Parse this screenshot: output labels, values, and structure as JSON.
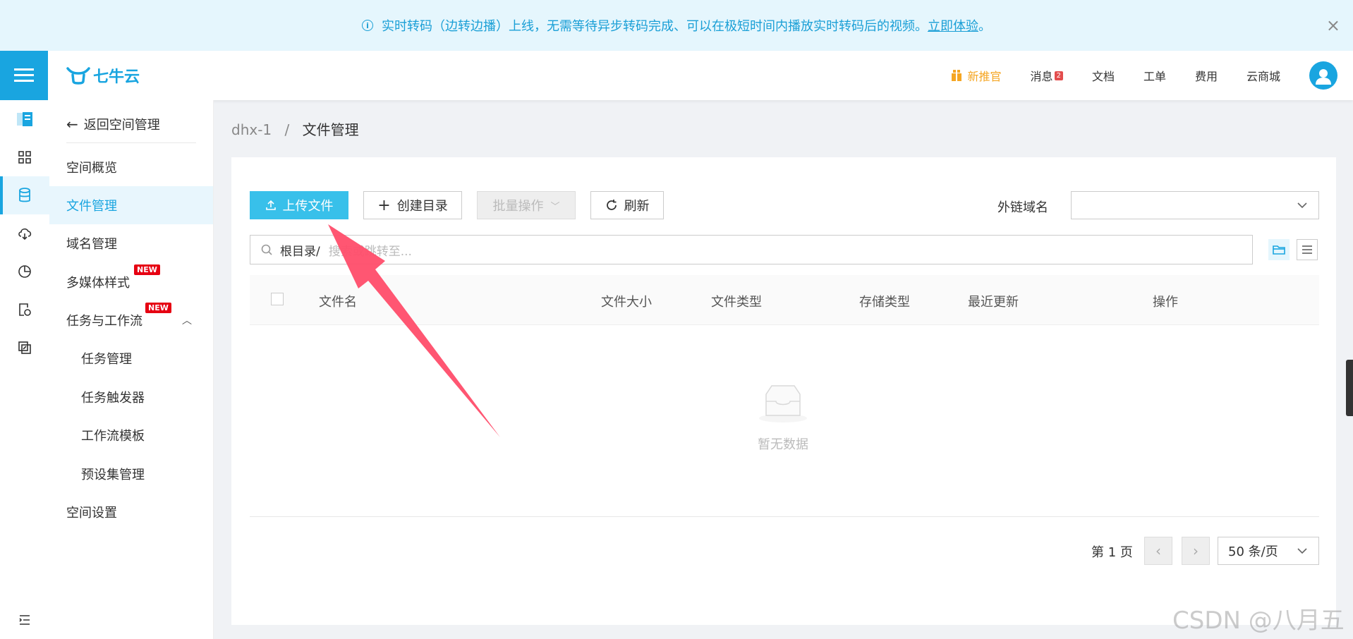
{
  "banner": {
    "text": "实时转码（边转边播）上线，无需等待异步转码完成、可以在极短时间内播放实时转码后的视频。",
    "link": "立即体验",
    "suffix": "。",
    "close": "×"
  },
  "header": {
    "logo": "七牛云",
    "nav": {
      "new_promo": "新推官",
      "messages": "消息",
      "messages_badge": "2",
      "docs": "文档",
      "ticket": "工单",
      "billing": "费用",
      "market": "云商城"
    }
  },
  "sidemenu": {
    "back": "返回空间管理",
    "items": [
      {
        "label": "空间概览"
      },
      {
        "label": "文件管理"
      },
      {
        "label": "域名管理"
      },
      {
        "label": "多媒体样式",
        "tag": "NEW"
      },
      {
        "label": "任务与工作流",
        "tag": "NEW"
      },
      {
        "label": "任务管理"
      },
      {
        "label": "任务触发器"
      },
      {
        "label": "工作流模板"
      },
      {
        "label": "预设集管理"
      },
      {
        "label": "空间设置"
      }
    ]
  },
  "breadcrumb": {
    "bucket": "dhx-1",
    "sep": "/",
    "current": "文件管理"
  },
  "toolbar": {
    "upload": "上传文件",
    "mkdir": "创建目录",
    "batch": "批量操作",
    "refresh": "刷新",
    "domain_label": "外链域名",
    "domain_value": ""
  },
  "search": {
    "root": "根目录/",
    "placeholder": "搜索或跳转至..."
  },
  "table": {
    "columns": [
      "文件名",
      "文件大小",
      "文件类型",
      "存储类型",
      "最近更新",
      "操作"
    ],
    "empty": "暂无数据"
  },
  "pager": {
    "page_text": "第 1 页",
    "size": "50 条/页"
  },
  "watermark": "CSDN @八月五",
  "colors": {
    "accent": "#19a5e0",
    "primary_button": "#38c0ea",
    "annotation_arrow": "#ff4d6a"
  }
}
